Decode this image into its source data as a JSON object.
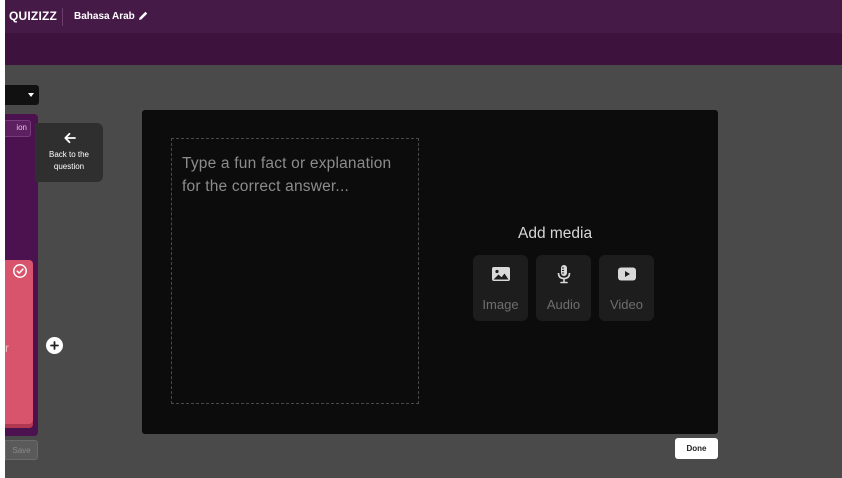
{
  "header": {
    "logo_text": "QUIZIZZ",
    "quiz_title": "Bahasa Arab",
    "edit_icon": "pencil-icon"
  },
  "sidebar": {
    "dropdown_icon": "caret-down-icon",
    "explanation_tab_label": "ion",
    "correct_icon": "check-circle-icon",
    "option_text_fragment": "r",
    "save_label": "Save"
  },
  "back_button": {
    "icon": "arrow-left-icon",
    "label_line1": "Back to the",
    "label_line2": "question"
  },
  "add_option_icon": "plus-icon",
  "explanation_editor": {
    "placeholder": "Type a fun fact or explanation for the correct answer..."
  },
  "media": {
    "title": "Add media",
    "buttons": [
      {
        "label": "Image",
        "icon": "image-icon"
      },
      {
        "label": "Audio",
        "icon": "microphone-icon"
      },
      {
        "label": "Video",
        "icon": "video-play-icon"
      }
    ]
  },
  "done_label": "Done",
  "colors": {
    "header_purple": "#461a47",
    "subheader_purple": "#3d133e",
    "workspace_gray": "#4a4a4a",
    "modal_black": "#0c0c0c",
    "option_pink": "#d8546c"
  }
}
